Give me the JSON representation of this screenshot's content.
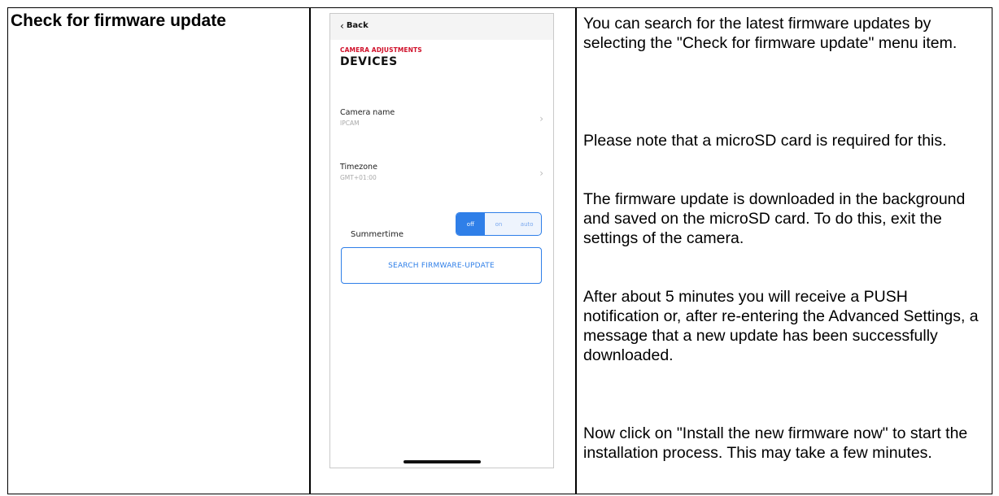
{
  "table": {
    "heading": "Check for firmware update"
  },
  "phone": {
    "back_label": "Back",
    "section_label": "CAMERA ADJUSTMENTS",
    "section_title": "DEVICES",
    "rows": [
      {
        "label": "Camera name",
        "value": "IPCAM"
      },
      {
        "label": "Timezone",
        "value": "GMT+01:00"
      }
    ],
    "summertime": {
      "label": "Summertime",
      "options": [
        "off",
        "on",
        "auto"
      ],
      "selected": "off"
    },
    "search_button": "SEARCH FIRMWARE-UPDATE",
    "colors": {
      "accent": "#2f7fe8",
      "brand_red": "#d0102a"
    }
  },
  "description": {
    "p1": "You can search for the latest firmware updates by selecting the \"Check for firmware update\" menu item.",
    "p2": "Please note that a microSD card is required for this.",
    "p3": "The firmware update is downloaded in the background and saved on the microSD card. To do this, exit the settings of the camera.",
    "p4": "After about 5 minutes you will receive a PUSH notification or, after re-entering the Advanced Settings, a message that a new update has been successfully downloaded.",
    "p5": "Now click on \"Install the new firmware now\" to start the installation process. This may take a few minutes."
  }
}
